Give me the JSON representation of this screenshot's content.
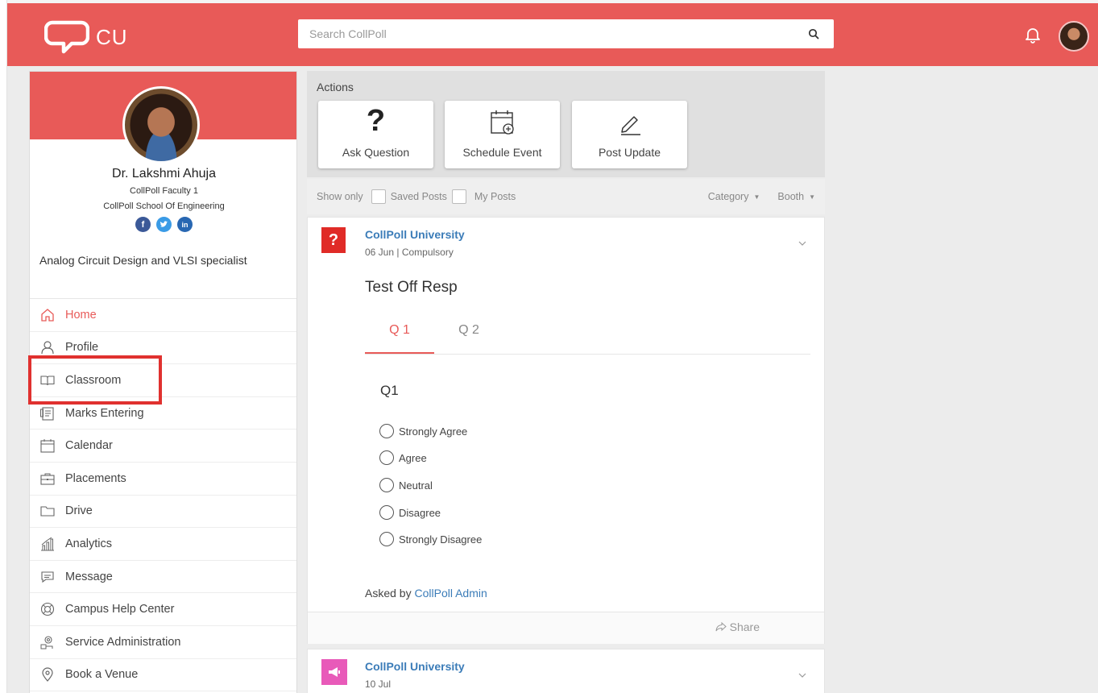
{
  "colors": {
    "brand": "#e85a58",
    "link": "#3b7cb8",
    "highlight": "#e0312f"
  },
  "header": {
    "logo_text": "CU",
    "search_placeholder": "Search CollPoll"
  },
  "profile": {
    "name": "Dr. Lakshmi Ahuja",
    "role": "CollPoll Faculty 1",
    "school": "CollPoll School Of Engineering",
    "socials": [
      "facebook-icon",
      "twitter-icon",
      "linkedin-icon"
    ],
    "bio": "Analog Circuit Design and VLSI specialist"
  },
  "nav": [
    {
      "label": "Home",
      "icon": "home-icon",
      "active": true
    },
    {
      "label": "Profile",
      "icon": "user-icon"
    },
    {
      "label": "Classroom",
      "icon": "book-icon",
      "highlighted": true
    },
    {
      "label": "Marks Entering",
      "icon": "marks-icon"
    },
    {
      "label": "Calendar",
      "icon": "calendar-icon"
    },
    {
      "label": "Placements",
      "icon": "briefcase-icon"
    },
    {
      "label": "Drive",
      "icon": "folder-icon"
    },
    {
      "label": "Analytics",
      "icon": "analytics-icon"
    },
    {
      "label": "Message",
      "icon": "message-icon"
    },
    {
      "label": "Campus Help Center",
      "icon": "lifebuoy-icon"
    },
    {
      "label": "Service Administration",
      "icon": "service-admin-icon"
    },
    {
      "label": "Book a Venue",
      "icon": "location-pin-icon"
    }
  ],
  "actions": {
    "title": "Actions",
    "items": [
      {
        "label": "Ask Question",
        "icon": "question-icon"
      },
      {
        "label": "Schedule Event",
        "icon": "calendar-add-icon"
      },
      {
        "label": "Post Update",
        "icon": "pencil-icon"
      }
    ]
  },
  "filters": {
    "show_only": "Show only",
    "saved_posts": "Saved Posts",
    "my_posts": "My Posts",
    "category": "Category",
    "booth": "Booth"
  },
  "posts": [
    {
      "author": "CollPoll University",
      "meta": "06 Jun | Compulsory",
      "badge": "?",
      "title": "Test Off Resp",
      "tabs": [
        "Q 1",
        "Q 2"
      ],
      "active_tab": 0,
      "question": "Q1",
      "options": [
        "Strongly Agree",
        "Agree",
        "Neutral",
        "Disagree",
        "Strongly Disagree"
      ],
      "asked_by_prefix": "Asked by",
      "asked_by": "CollPoll Admin",
      "share": "Share"
    },
    {
      "author": "CollPoll University",
      "meta": "10 Jul"
    }
  ]
}
